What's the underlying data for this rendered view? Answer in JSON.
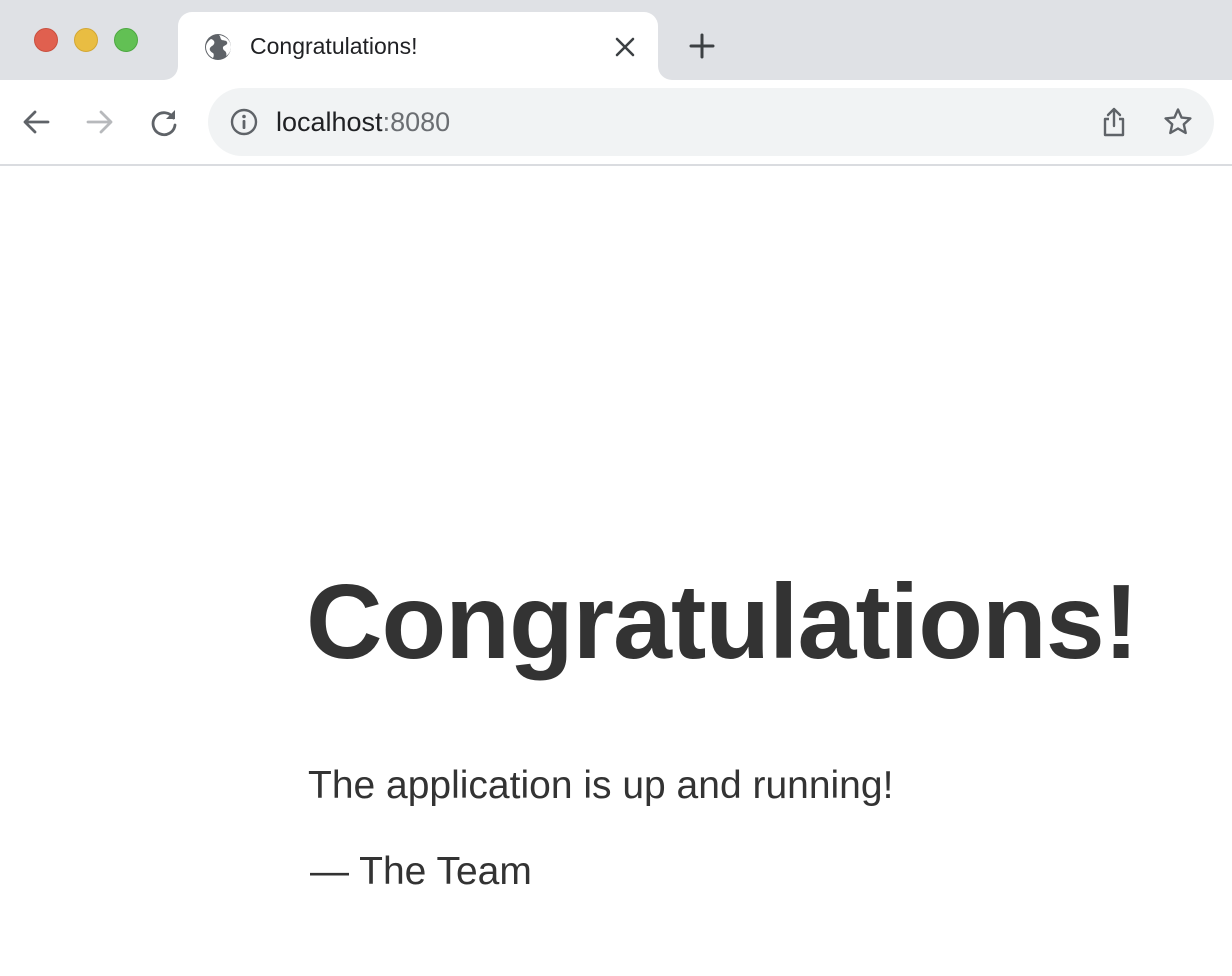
{
  "window": {
    "controls": [
      "close",
      "minimize",
      "zoom"
    ],
    "colors": {
      "close": "#e0604f",
      "minimize": "#e9bd42",
      "zoom": "#62c054"
    }
  },
  "tabs": [
    {
      "title": "Congratulations!",
      "favicon": "globe-icon",
      "active": true
    }
  ],
  "toolbar": {
    "back_icon": "arrow-left-icon",
    "forward_icon": "arrow-right-icon",
    "reload_icon": "reload-icon",
    "forward_enabled": false
  },
  "address_bar": {
    "host": "localhost",
    "port": ":8080",
    "site_info_icon": "info-icon",
    "share_icon": "share-icon",
    "bookmark_icon": "star-icon"
  },
  "page": {
    "headline": "Congratulations!",
    "message": "The application is up and running!",
    "signature": "— The Team",
    "text_color": "#333333"
  }
}
